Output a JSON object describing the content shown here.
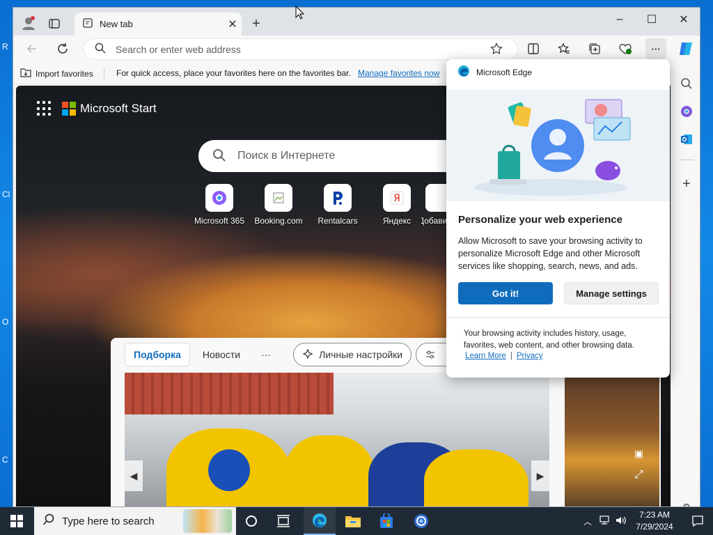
{
  "colors": {
    "accent": "#0f6cbd",
    "taskbar": "#1f2a36",
    "desktop": "#0a6ed1"
  },
  "browser": {
    "tab_title": "New tab",
    "address_placeholder": "Search or enter web address",
    "favorites_bar": {
      "import_label": "Import favorites",
      "message": "For quick access, place your favorites here on the favorites bar.",
      "manage_link": "Manage favorites now"
    }
  },
  "start_page": {
    "brand": "Microsoft Start",
    "search_placeholder": "Поиск в Интернете",
    "tiles": [
      {
        "label": "Microsoft 365",
        "icon": "m365-icon"
      },
      {
        "label": "Booking.com",
        "icon": "booking-icon"
      },
      {
        "label": "Rentalcars",
        "icon": "rentalcars-icon"
      },
      {
        "label": "Яндекс",
        "icon": "yandex-icon"
      },
      {
        "label": "Добавить",
        "icon": "add-site-icon"
      }
    ],
    "feed_tabs": [
      "Подборка",
      "Новости",
      "···",
      "Личные настройки"
    ]
  },
  "popup": {
    "header": "Microsoft Edge",
    "title": "Personalize your web experience",
    "body": "Allow Microsoft to save your browsing activity to personalize Microsoft Edge and other Microsoft services like shopping, search, news, and ads.",
    "got_it": "Got it!",
    "manage_settings": "Manage settings",
    "footer": "Your browsing activity includes history, usage, favorites, web content, and other browsing data.",
    "learn_more": "Learn More",
    "privacy": "Privacy",
    "separator": "|"
  },
  "taskbar": {
    "search_placeholder": "Type here to search",
    "time": "7:23 AM",
    "date": "7/29/2024"
  },
  "desktop_fragments": [
    "R",
    "Cl",
    "O",
    "C"
  ]
}
